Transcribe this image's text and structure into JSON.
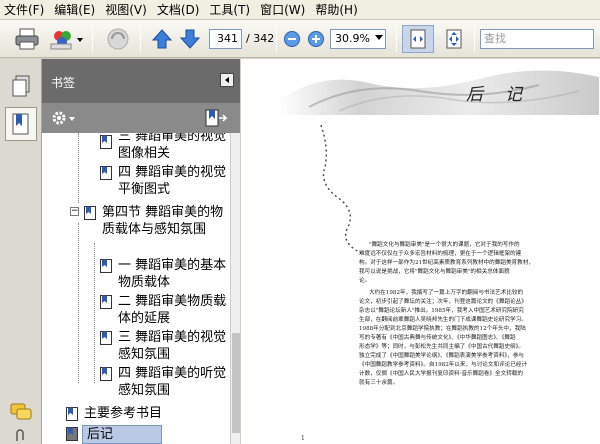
{
  "menu": [
    "文件(F)",
    "编辑(E)",
    "视图(V)",
    "文档(D)",
    "工具(T)",
    "窗口(W)",
    "帮助(H)"
  ],
  "toolbar": {
    "current_page": "341",
    "total_pages": "/ 342",
    "zoom": "30.9%",
    "search_placeholder": "查找"
  },
  "bookmarks": {
    "title": "书签",
    "items": [
      {
        "text": "三 舞蹈审美的视觉图像相关",
        "level": 2
      },
      {
        "text": "四 舞蹈审美的视觉平衡图式",
        "level": 2
      },
      {
        "text": "第四节 舞蹈审美的物质载体与感知氛围",
        "level": 1
      },
      {
        "text": "一 舞蹈审美的基本物质载体",
        "level": 2
      },
      {
        "text": "二 舞蹈审美物质载体的延展",
        "level": 2
      },
      {
        "text": "三 舞蹈审美的视觉感知氛围",
        "level": 2
      },
      {
        "text": "四 舞蹈审美的听觉感知氛围",
        "level": 2
      },
      {
        "text": "主要参考书目",
        "level": 0
      },
      {
        "text": "后记",
        "level": 0,
        "selected": true
      }
    ]
  },
  "document": {
    "heading": "后记",
    "paragraphs": [
      "\"舞蹈文化与舞蹈审美\"是一个很大的课题，它对于我的写作的",
      "难度远不仅仅在于众多宏旨材料的梳理，更在于一个逻辑框架的建",
      "构。对于这样一部作为21世纪高素质教育系列教材中的舞蹈美育教材，",
      "我可以说是挑战，它将\"舞蹈文化与舞蹈审美\"的相关总体面貌",
      "论。",
      "大约在1982年，我撰写了一篇上万字的翻阅与书法艺术比较的",
      "论文，初步引起了舞坛的关注；次年，刊登这篇论文的《舞蹈论丛》",
      "杂志以\"舞蹈论坛新人\"推出。1985年，我考入中国艺术研究院研究",
      "生部，在翻阅前辈舞蹈人吴晓邦先生的门下成课舞蹈史论研究学习。",
      "1988年分配到北京舞蹈学院执教；在舞蹈执教的12个年头中，我陆",
      "写的专著有《中国古典舞与传统文化》、《中华舞蹈图志》、《舞蹈",
      "形态学》等；同时，与彭松先生共同主编了《中国古代舞蹈史纲》。",
      "独立完成了《中国舞蹈美学论纲》、《舞蹈表演美学参考资料》，参与",
      "《中国舞蹈教学参考资料》。自1982年以来，与讨论文和评论已经计",
      "计数，仅搁《中国人民大学报刊复印资料·音乐舞蹈卷》全文转载的",
      "就有三十余篇。"
    ],
    "footer": "1"
  }
}
